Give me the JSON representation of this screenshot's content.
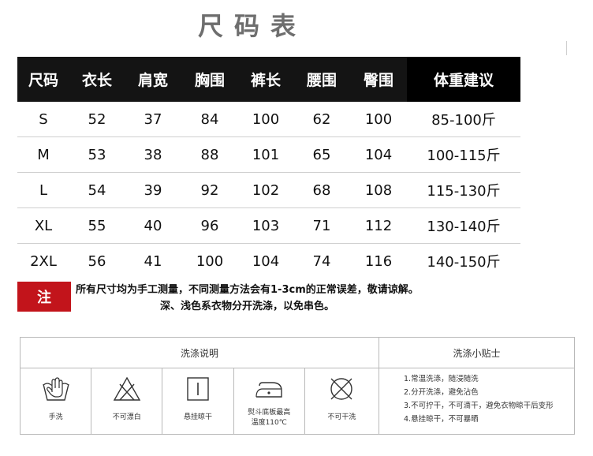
{
  "title": "尺码表",
  "size_table": {
    "headers": [
      "尺码",
      "衣长",
      "肩宽",
      "胸围",
      "裤长",
      "腰围",
      "臀围",
      "体重建议"
    ],
    "rows": [
      [
        "S",
        "52",
        "37",
        "84",
        "100",
        "62",
        "100",
        "85-100斤"
      ],
      [
        "M",
        "53",
        "38",
        "88",
        "101",
        "65",
        "104",
        "100-115斤"
      ],
      [
        "L",
        "54",
        "39",
        "92",
        "102",
        "68",
        "108",
        "115-130斤"
      ],
      [
        "XL",
        "55",
        "40",
        "96",
        "103",
        "71",
        "112",
        "130-140斤"
      ],
      [
        "2XL",
        "56",
        "41",
        "100",
        "104",
        "74",
        "116",
        "140-150斤"
      ]
    ]
  },
  "note": {
    "badge": "注",
    "line1": "所有尺寸均为手工测量，不同测量方法会有1-3cm的正常误差，敬请谅解。",
    "line2": "深、浅色系衣物分开洗涤，以免串色。",
    "badge_color": "#c2141b"
  },
  "care": {
    "wash_title": "洗涤说明",
    "tips_title": "洗涤小贴士",
    "icons": [
      {
        "icon": "hand-wash-icon",
        "label": "手洗"
      },
      {
        "icon": "no-bleach-icon",
        "label": "不可漂白"
      },
      {
        "icon": "hang-dry-icon",
        "label": "悬挂晾干"
      },
      {
        "icon": "iron-icon",
        "label": "熨斗底板最高",
        "label2": "温度110℃"
      },
      {
        "icon": "no-tumble-dry-icon",
        "label": "不可干洗"
      }
    ],
    "tips": [
      "1.常温洗涤，随浸随洗",
      "2.分开洗涤，避免沾色",
      "3.不可拧干，不可滴干，避免衣物晾干后变形",
      "4.悬挂晾干，不可暴晒"
    ]
  }
}
